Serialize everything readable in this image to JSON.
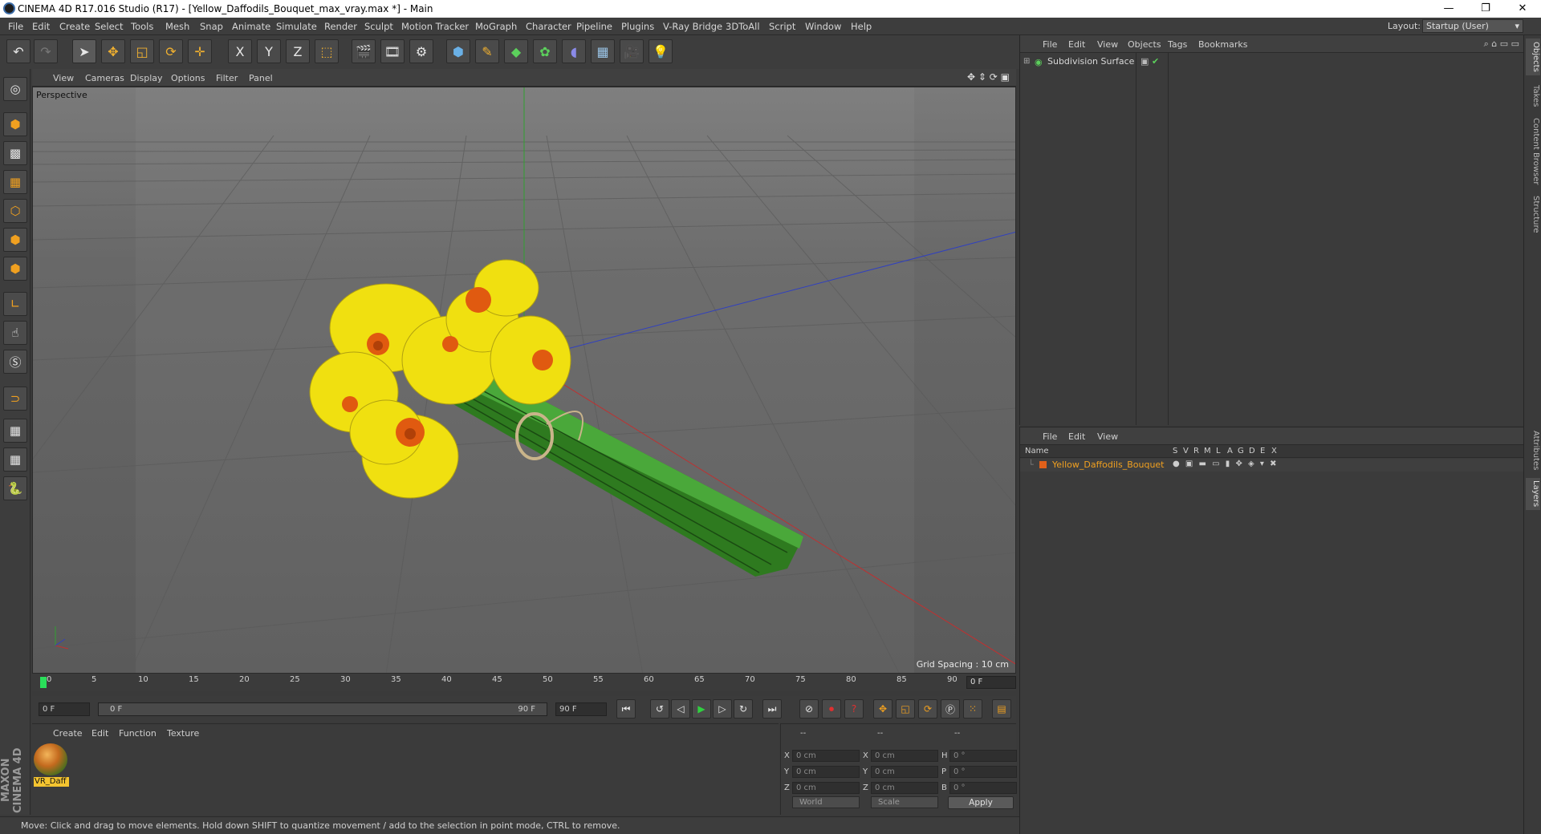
{
  "window": {
    "title": "CINEMA 4D R17.016 Studio (R17) - [Yellow_Daffodils_Bouquet_max_vray.max *] - Main",
    "minimize": "—",
    "restore": "❐",
    "close": "✕"
  },
  "menubar": {
    "items": [
      "File",
      "Edit",
      "Create",
      "Select",
      "Tools",
      "Mesh",
      "Snap",
      "Animate",
      "Simulate",
      "Render",
      "Sculpt",
      "Motion Tracker",
      "MoGraph",
      "Character",
      "Pipeline",
      "Plugins",
      "V-Ray Bridge",
      "3DToAll",
      "Script",
      "Window",
      "Help"
    ],
    "layout_label": "Layout:",
    "layout_value": "Startup (User)"
  },
  "toolbar": {
    "icons": [
      "undo-icon",
      "redo-icon",
      "select-arrow-icon",
      "move-icon",
      "scale-icon",
      "rotate-icon",
      "live-select-icon",
      "x-axis-icon",
      "y-axis-icon",
      "z-axis-icon",
      "coordinate-system-icon",
      "render-view-icon",
      "render-picture-viewer-icon",
      "edit-render-settings-icon",
      "cube-icon",
      "pen-spline-icon",
      "subdivision-surface-icon",
      "cloner-icon",
      "deformer-icon",
      "floor-icon",
      "camera-icon",
      "light-icon"
    ],
    "glyphs": {
      "x": "X",
      "y": "Y",
      "z": "Z"
    }
  },
  "left_tools": [
    "model-mode-icon",
    "texture-mode-icon",
    "workplane-icon",
    "points-mode-icon",
    "edges-mode-icon",
    "polygons-mode-icon",
    "axis-mode-icon",
    "tweak-mode-icon",
    "solo-icon",
    "snap-magnet-icon",
    "locked-workplane-icon",
    "planar-workplane-icon",
    "python-icon"
  ],
  "viewport": {
    "menu": [
      "View",
      "Cameras",
      "Display",
      "Options",
      "Filter",
      "Panel"
    ],
    "label": "Perspective",
    "grid_spacing": "Grid Spacing : 10 cm"
  },
  "timeline": {
    "ticks": [
      "0",
      "5",
      "10",
      "15",
      "20",
      "25",
      "30",
      "35",
      "40",
      "45",
      "50",
      "55",
      "60",
      "65",
      "70",
      "75",
      "80",
      "85",
      "90"
    ],
    "current_frame": "0 F"
  },
  "transport": {
    "start_field": "0 F",
    "range_start": "0 F",
    "range_end": "90 F",
    "end_field": "90 F"
  },
  "materials": {
    "menu": [
      "Create",
      "Edit",
      "Function",
      "Texture"
    ],
    "items": [
      {
        "label": "VR_Daff"
      }
    ]
  },
  "coordinates": {
    "headers": [
      "--",
      "--",
      "--"
    ],
    "rows": [
      {
        "a": "X",
        "av": "0 cm",
        "b": "X",
        "bv": "0 cm",
        "c": "H",
        "cv": "0 °"
      },
      {
        "a": "Y",
        "av": "0 cm",
        "b": "Y",
        "bv": "0 cm",
        "c": "P",
        "cv": "0 °"
      },
      {
        "a": "Z",
        "av": "0 cm",
        "b": "Z",
        "bv": "0 cm",
        "c": "B",
        "cv": "0 °"
      }
    ],
    "world": "World",
    "scale": "Scale",
    "apply": "Apply"
  },
  "status": "Move: Click and drag to move elements. Hold down SHIFT to quantize movement / add to the selection in point mode, CTRL to remove.",
  "objects_panel": {
    "menu": [
      "File",
      "Edit",
      "View",
      "Objects",
      "Tags",
      "Bookmarks"
    ],
    "items": [
      {
        "name": "Subdivision Surface"
      }
    ]
  },
  "layers_panel": {
    "menu": [
      "File",
      "Edit",
      "View"
    ],
    "header_name": "Name",
    "columns": [
      "S",
      "V",
      "R",
      "M",
      "L",
      "A",
      "G",
      "D",
      "E",
      "X"
    ],
    "items": [
      {
        "name": "Yellow_Daffodils_Bouquet",
        "color": "#e0601a"
      }
    ]
  },
  "right_tabs": [
    "Objects",
    "Takes",
    "Content Browser",
    "Structure",
    "Attributes",
    "Layers"
  ],
  "brand": "MAXON CINEMA 4D",
  "colors": {
    "accent": "#f0a020",
    "x_axis": "#c03030",
    "y_axis": "#30a030",
    "z_axis": "#3040c0"
  }
}
